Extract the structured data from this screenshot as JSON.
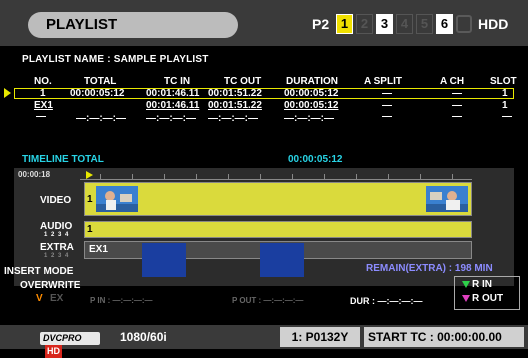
{
  "header": {
    "title": "PLAYLIST",
    "p2_label": "P2",
    "slots": [
      "1",
      "2",
      "3",
      "4",
      "5",
      "6"
    ],
    "hdd_label": "HDD"
  },
  "playlist_name": "PLAYLIST NAME : SAMPLE PLAYLIST",
  "columns": [
    "NO.",
    "TOTAL",
    "TC IN",
    "TC OUT",
    "DURATION",
    "A SPLIT",
    "A CH",
    "SLOT"
  ],
  "rows": [
    {
      "no": "1",
      "total": "00:00:05:12",
      "tc_in": "00:01:46.11",
      "tc_out": "00:01:51.22",
      "duration": "00:00:05:12",
      "a_split": "—",
      "a_ch": "—",
      "slot": "1"
    },
    {
      "no": "EX1",
      "total": "",
      "tc_in": "00:01:46.11",
      "tc_out": "00:01:51.22",
      "duration": "00:00:05:12",
      "a_split": "—",
      "a_ch": "—",
      "slot": "1"
    },
    {
      "no": "—",
      "total": "—:—:—:—",
      "tc_in": "—:—:—:—",
      "tc_out": "—:—:—:—",
      "duration": "—:—:—:—",
      "a_split": "—",
      "a_ch": "—",
      "slot": "—"
    }
  ],
  "timeline_total_label": "TIMELINE TOTAL",
  "timeline_total_value": "00:00:05:12",
  "ruler_time": "00:00:18",
  "tracks": {
    "video_label": "VIDEO",
    "video_clip": "1",
    "audio_label": "AUDIO",
    "audio_sub": "1 2 3 4",
    "audio_clip": "1",
    "extra_label": "EXTRA",
    "extra_sub": "1 2 3 4",
    "extra_clip": "EX1"
  },
  "insert_mode": {
    "line1": "INSERT MODE",
    "line2": "OVERWRITE",
    "v": "V",
    "ex": "EX"
  },
  "p_in": "P IN : —:—:—:—",
  "p_out": "P OUT : —:—:—:—",
  "remain": "REMAIN(EXTRA) : 198 MIN",
  "dur": "DUR : —:—:—:—",
  "r_in": "R IN",
  "r_out": "R OUT",
  "footer": {
    "logo_text": "DVCPRO",
    "logo_hd": "HD",
    "format": "1080/60i",
    "clip": "1: P0132Y",
    "start_tc": "START TC  : 00:00:00.00"
  },
  "colors": {
    "accent_yellow": "#e8e800",
    "cyan": "#28d4e6",
    "remain_purple": "#8c8cff",
    "green": "#2ed14a",
    "magenta": "#e040c0"
  }
}
